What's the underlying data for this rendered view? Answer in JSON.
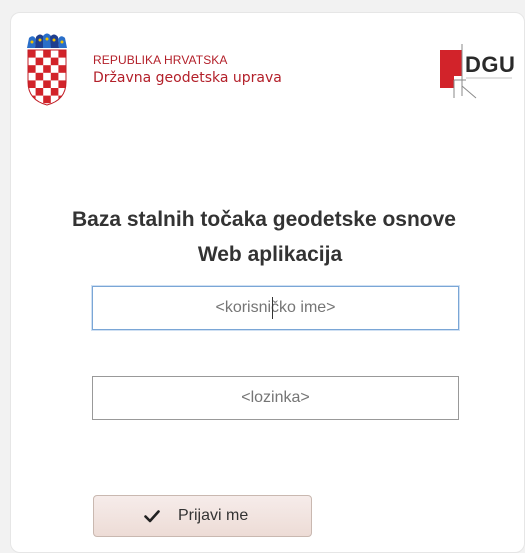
{
  "header": {
    "country": "REPUBLIKA HRVATSKA",
    "agency": "Državna geodetska uprava",
    "logo_text": "DGU"
  },
  "main": {
    "title_line1": "Baza stalnih točaka geodetske osnove",
    "title_line2": "Web aplikacija"
  },
  "login": {
    "username_placeholder": "<korisničko ime>",
    "password_placeholder": "<lozinka>",
    "submit_label": "Prijavi me",
    "submit_icon": "checkmark-icon"
  },
  "colors": {
    "brand_red": "#b3202a",
    "focus_border": "#7aa6d6",
    "button_bg": "#f1e2dd"
  }
}
